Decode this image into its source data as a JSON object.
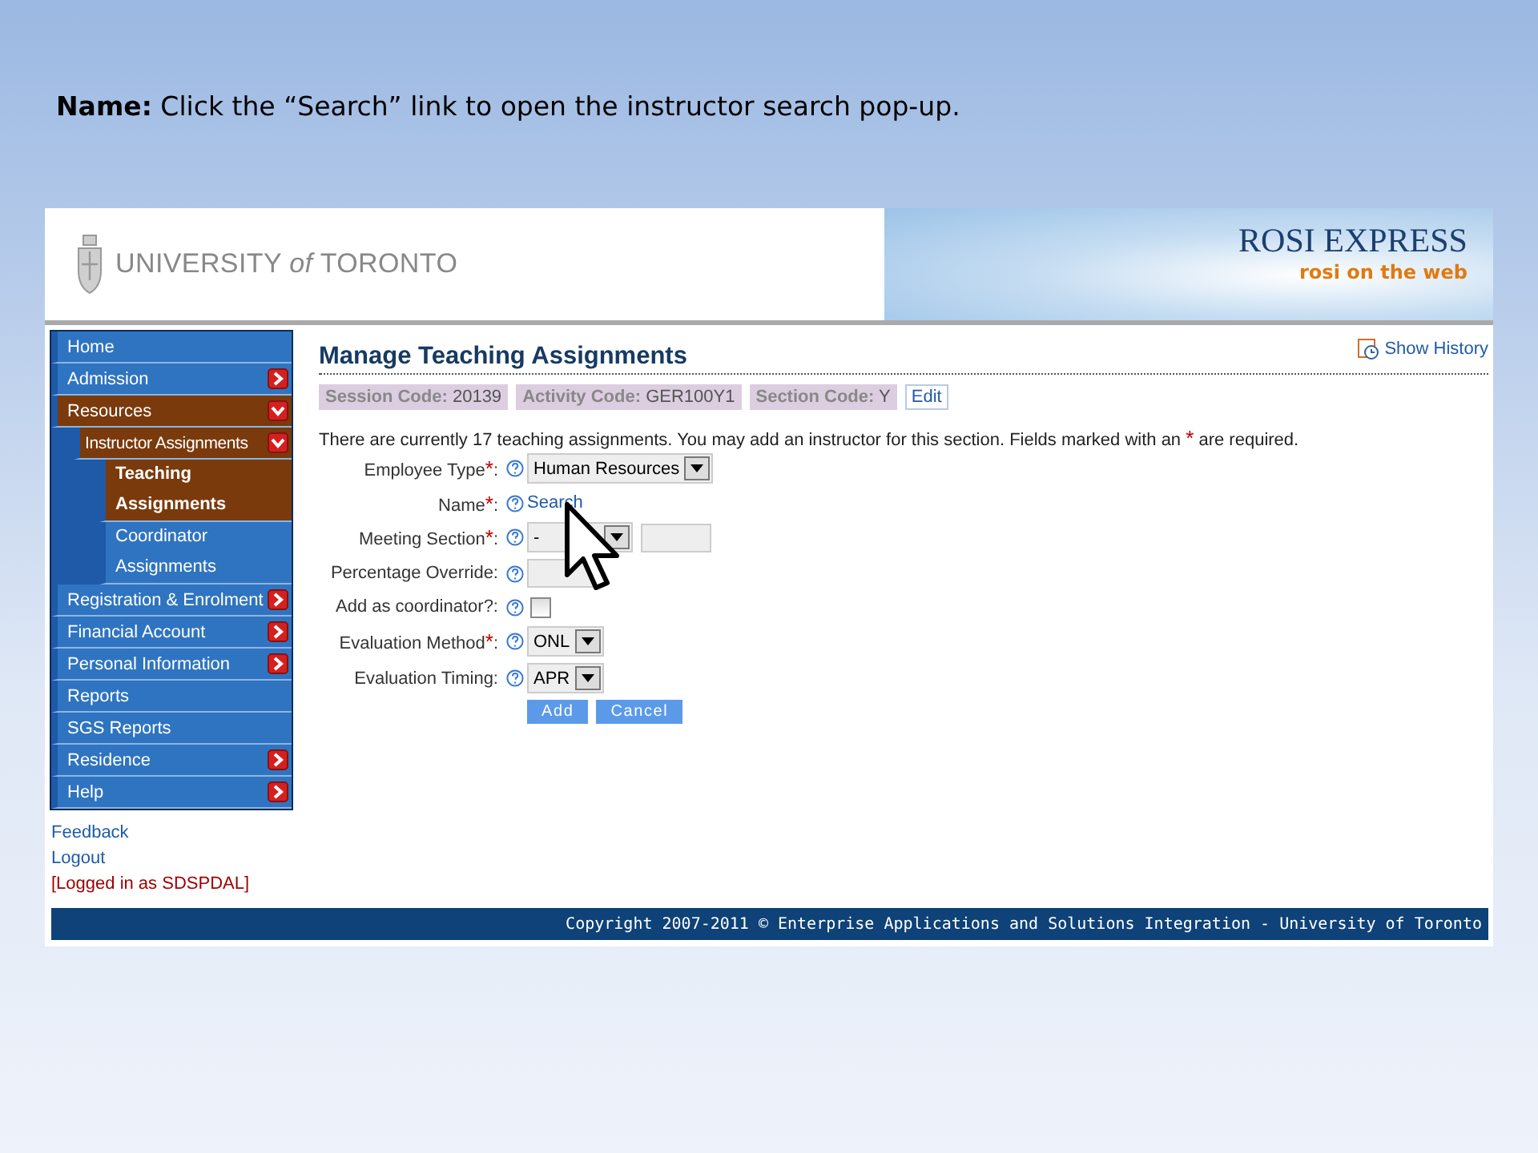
{
  "slide_caption": "**Name:** Click the “Search” link to open the instructor search pop-up.",
  "header": {
    "logo": "UNIVERSITY *of* TORONTO",
    "app_title": "ROSI EXPRESS",
    "tagline": "rosi on the web"
  },
  "nav": [
    {
      "label": "Home",
      "kind": "top",
      "selected": false
    },
    {
      "label": "Admission",
      "kind": "top",
      "selected": false,
      "expanded": false
    },
    {
      "label": "Resources",
      "kind": "top",
      "selected": true,
      "expanded": true
    },
    {
      "label": "Instructor Assignments",
      "kind": "sub",
      "selected": true,
      "expanded": true
    },
    {
      "label": "Teaching Assignments",
      "kind": "leaf",
      "selected": true
    },
    {
      "label": "Coordinator Assignments",
      "kind": "leaf",
      "selected": false
    },
    {
      "label": "Registration & Enrolment",
      "kind": "top",
      "selected": false,
      "expanded": false
    },
    {
      "label": "Financial Account",
      "kind": "top",
      "selected": false,
      "expanded": false
    },
    {
      "label": "Personal Information",
      "kind": "top",
      "selected": false,
      "expanded": false
    },
    {
      "label": "Reports",
      "kind": "top",
      "selected": false
    },
    {
      "label": "SGS Reports",
      "kind": "top",
      "selected": false
    },
    {
      "label": "Residence",
      "kind": "top",
      "selected": false,
      "expanded": false
    },
    {
      "label": "Help",
      "kind": "top",
      "selected": false,
      "expanded": false
    }
  ],
  "side_links": [
    {
      "label": "Feedback",
      "kind": "link"
    },
    {
      "label": "Logout",
      "kind": "link"
    },
    {
      "label": "[Logged in as SDSPDAL]",
      "kind": "status"
    }
  ],
  "page_title": "Manage Teaching Assignments",
  "show_history": "Show History",
  "codes": [
    {
      "label": "Session Code:",
      "value": "20139"
    },
    {
      "label": "Activity Code:",
      "value": "GER100Y1"
    },
    {
      "label": "Section Code:",
      "value": "Y"
    }
  ],
  "edit_link": "Edit",
  "intro": "There are currently 17 teaching assignments. You may add an instructor for this section. Fields marked with an",
  "required_mark": "*",
  "intro_end": "are required.",
  "fields": [
    {
      "label": "Employee Type",
      "required": true,
      "label_end": ":",
      "kind": "select",
      "value": "Human Resources"
    },
    {
      "label": "Name",
      "required": true,
      "label_end": ":",
      "kind": "link",
      "value": "Search"
    },
    {
      "label": "Meeting Section",
      "required": true,
      "label_end": ":",
      "kind": "select_input",
      "value": "-"
    },
    {
      "label": "Percentage Override:",
      "required": false,
      "kind": "input"
    },
    {
      "label": "Add as coordinator?:",
      "required": false,
      "kind": "checkbox",
      "checked": false
    },
    {
      "label": "Evaluation Method",
      "required": true,
      "label_end": ":",
      "kind": "select",
      "value": "ONL"
    },
    {
      "label": "Evaluation Timing:",
      "required": false,
      "kind": "select",
      "value": "APR"
    }
  ],
  "buttons": [
    "Add",
    "Cancel"
  ],
  "footer": "Copyright 2007-2011 © Enterprise Applications and Solutions Integration - University of Toronto"
}
